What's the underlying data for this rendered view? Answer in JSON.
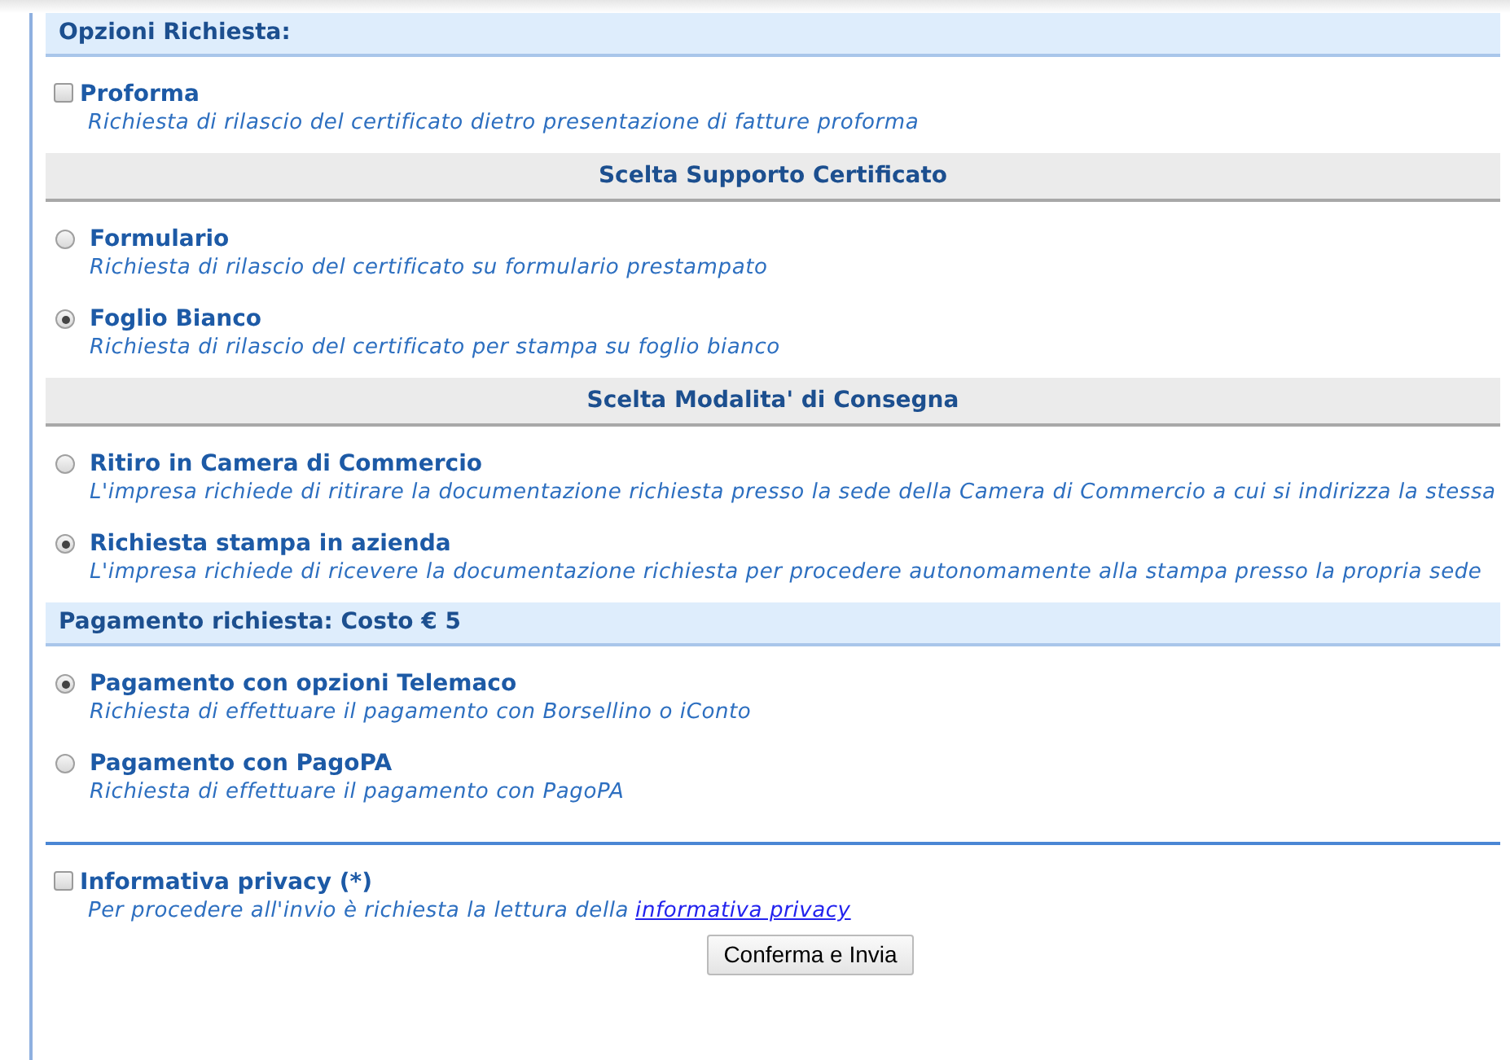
{
  "blocks": [
    {
      "kind": "title",
      "text": "Opzioni Richiesta:"
    },
    {
      "kind": "checkbox_option",
      "checked": false,
      "label": "Proforma",
      "description": "Richiesta di rilascio del certificato dietro presentazione di fatture proforma"
    },
    {
      "kind": "subtitle",
      "text": "Scelta Supporto Certificato"
    },
    {
      "kind": "radio_option",
      "selected": false,
      "label": "Formulario",
      "description": "Richiesta di rilascio del certificato su formulario prestampato"
    },
    {
      "kind": "radio_option",
      "selected": true,
      "label": "Foglio Bianco",
      "description": "Richiesta di rilascio del certificato per stampa su foglio bianco"
    },
    {
      "kind": "subtitle",
      "text": "Scelta Modalita' di Consegna"
    },
    {
      "kind": "radio_option",
      "selected": false,
      "label": "Ritiro in Camera di Commercio",
      "description": "L'impresa richiede di ritirare la documentazione richiesta presso la sede della Camera di Commercio a cui si indirizza la stessa"
    },
    {
      "kind": "radio_option",
      "selected": true,
      "label": "Richiesta stampa in azienda",
      "description": "L'impresa richiede di ricevere la documentazione richiesta per procedere autonomamente alla stampa presso la propria sede"
    },
    {
      "kind": "title",
      "text": "Pagamento richiesta: Costo € 5"
    },
    {
      "kind": "radio_option",
      "selected": true,
      "label": "Pagamento con opzioni Telemaco",
      "description": "Richiesta di effettuare il pagamento con Borsellino o iConto"
    },
    {
      "kind": "radio_option",
      "selected": false,
      "label": "Pagamento con PagoPA",
      "description": "Richiesta di effettuare il pagamento con PagoPA"
    },
    {
      "kind": "rule"
    },
    {
      "kind": "checkbox_option",
      "checked": false,
      "label": "Informativa privacy (*)",
      "description": "Per procedere all'invio è richiesta la lettura della",
      "link": "informativa privacy"
    }
  ],
  "submit_button": "Conferma e Invia"
}
